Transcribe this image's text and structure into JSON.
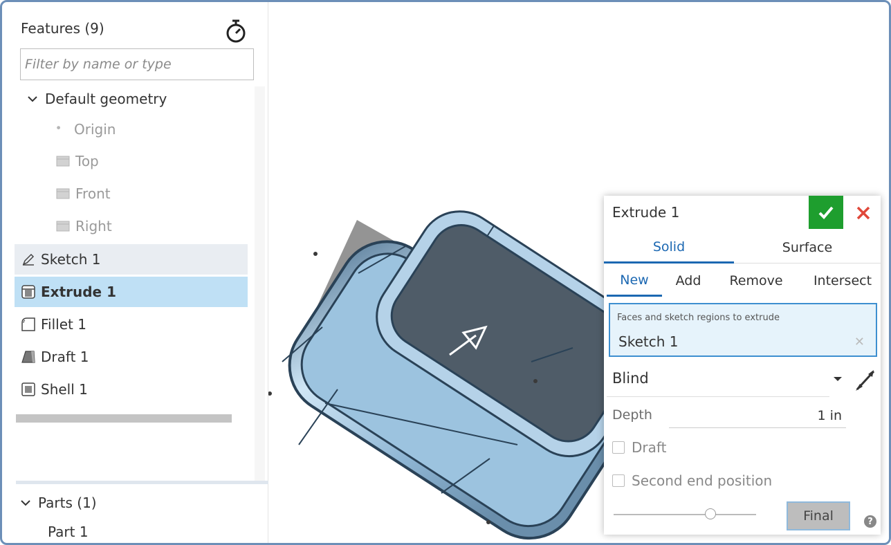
{
  "features_panel": {
    "title": "Features (9)",
    "filter_placeholder": "Filter by name or type",
    "default_geometry": {
      "label": "Default geometry",
      "items": [
        "Origin",
        "Top",
        "Front",
        "Right"
      ]
    },
    "features": [
      {
        "label": "Sketch 1",
        "icon": "sketch-icon"
      },
      {
        "label": "Extrude 1",
        "icon": "extrude-icon",
        "selected": true
      },
      {
        "label": "Fillet 1",
        "icon": "fillet-icon"
      },
      {
        "label": "Draft 1",
        "icon": "draft-icon"
      },
      {
        "label": "Shell 1",
        "icon": "shell-icon"
      }
    ],
    "parts": {
      "label": "Parts (1)",
      "items": [
        "Part 1"
      ]
    }
  },
  "dialog": {
    "title": "Extrude 1",
    "tabs": [
      "Solid",
      "Surface"
    ],
    "active_tab": "Solid",
    "operations": [
      "New",
      "Add",
      "Remove",
      "Intersect"
    ],
    "active_operation": "New",
    "selection_label": "Faces and sketch regions to extrude",
    "selection_value": "Sketch 1",
    "end_type": "Blind",
    "depth_label": "Depth",
    "depth_value": "1 in",
    "draft_label": "Draft",
    "second_end_label": "Second end position",
    "final_button": "Final",
    "help": "?",
    "colors": {
      "accent": "#1c68b2",
      "confirm": "#1e9e2e",
      "cancel": "#e0483a",
      "selected_row": "#bfe0f5"
    }
  }
}
